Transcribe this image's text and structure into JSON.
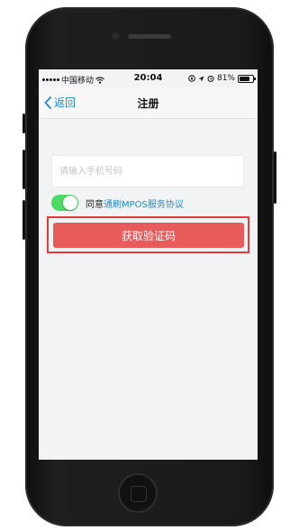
{
  "status_bar": {
    "carrier": "中国移动",
    "time": "20:04",
    "battery": "81%",
    "battery_level": 0.81
  },
  "nav": {
    "back_label": "返回",
    "title": "注册"
  },
  "form": {
    "phone_placeholder": "请输入手机号码",
    "agree_prefix": "同意",
    "agreement_link": "通刷MPOS服务协议",
    "toggle_on": true,
    "submit_label": "获取验证码"
  },
  "colors": {
    "link": "#1a8bd1",
    "toggle_on": "#4cd964",
    "button": "#e85b5b",
    "highlight": "#e63a3a"
  },
  "icons": {
    "back": "chevron-left-icon",
    "wifi": "wifi-icon",
    "signal": "signal-dots-icon",
    "location": "location-icon",
    "alarm": "alarm-icon",
    "battery": "battery-icon"
  }
}
